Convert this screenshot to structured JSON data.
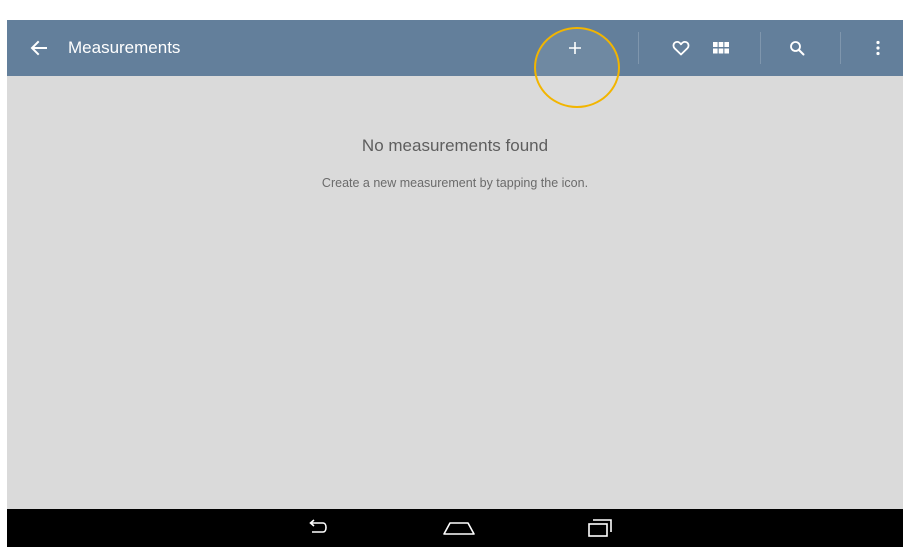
{
  "actionbar": {
    "title": "Measurements",
    "background_color": "#637f9b",
    "icons": {
      "back": "arrow-left-icon",
      "add": "plus-icon",
      "favorite": "heart-icon",
      "grid": "grid-icon",
      "search": "search-icon",
      "more": "more-vertical-icon"
    },
    "add_label": "+"
  },
  "highlight": {
    "color": "#f2b500",
    "target": "add-button"
  },
  "empty_state": {
    "title": "No measurements found",
    "subtitle": "Create a new measurement by tapping the icon."
  },
  "navbar": {
    "icons": [
      "back-nav-icon",
      "home-nav-icon",
      "recents-nav-icon"
    ]
  },
  "colors": {
    "content_background": "#dadada",
    "navbar_background": "#000000"
  }
}
